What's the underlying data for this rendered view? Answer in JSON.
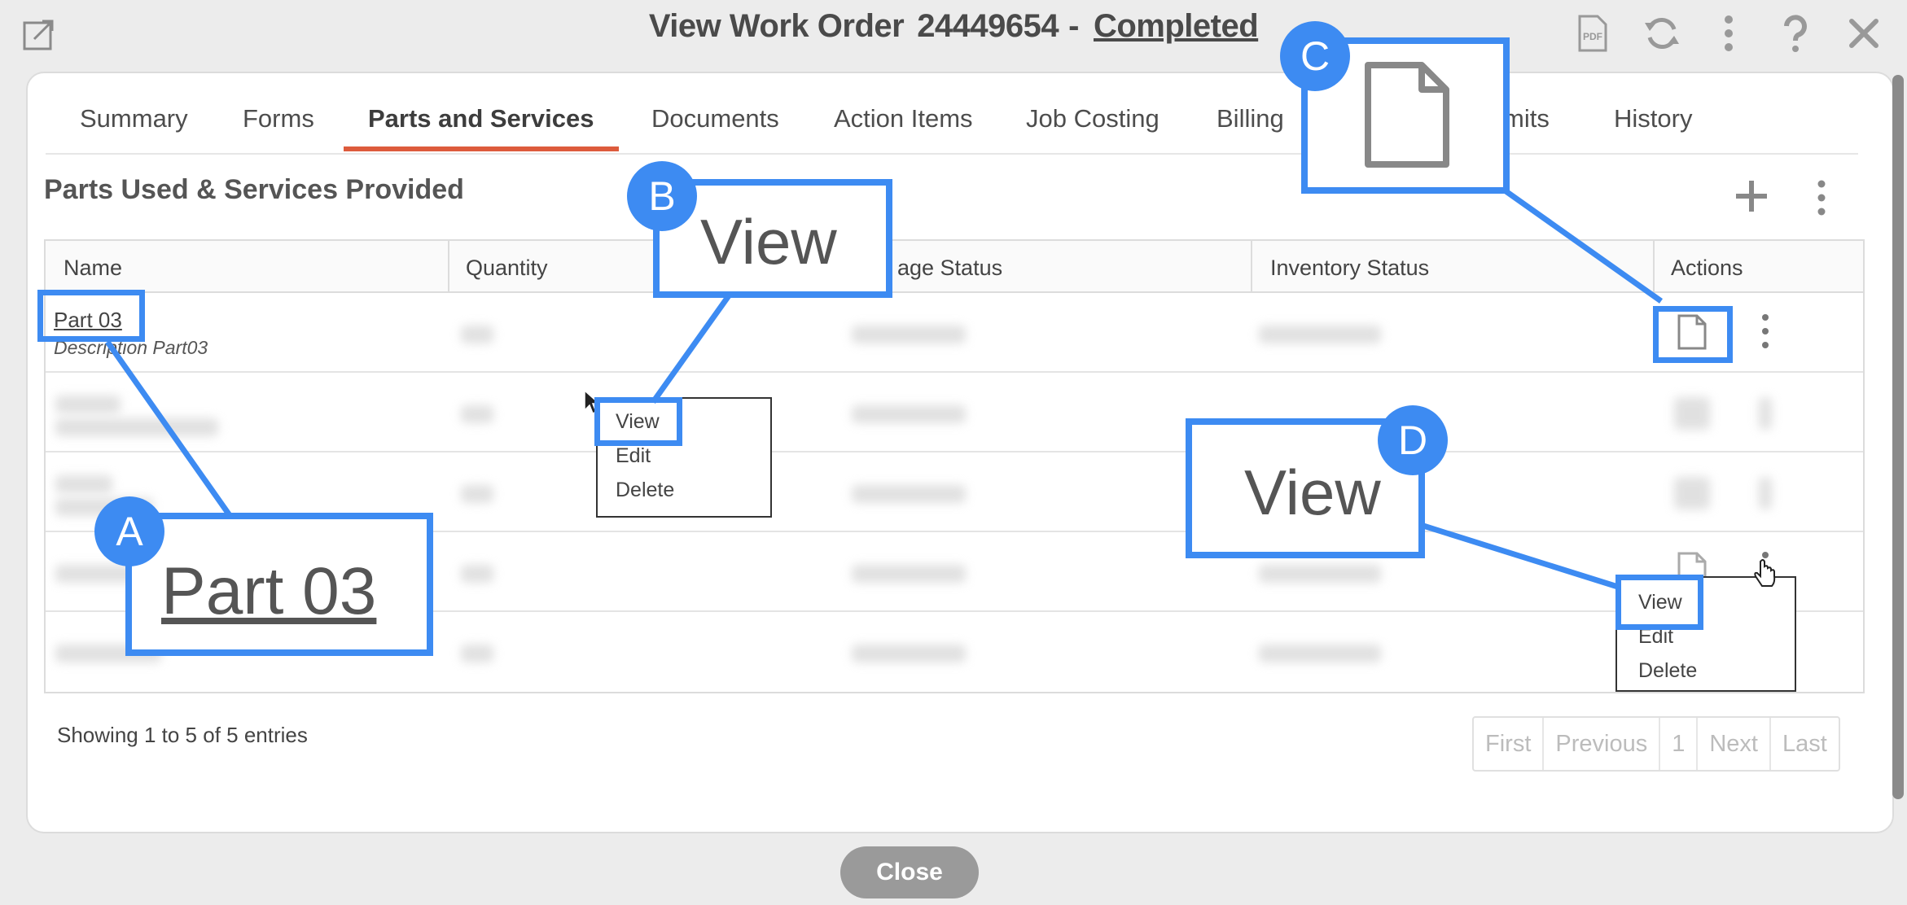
{
  "header": {
    "title_prefix": "View Work Order",
    "order_number": "24449654",
    "separator": "-",
    "status": "Completed"
  },
  "header_icons": [
    "pdf-icon",
    "refresh-icon",
    "more-vertical-icon",
    "help-icon",
    "close-icon"
  ],
  "pdf_label": "PDF",
  "tabs": [
    {
      "label": "Summary"
    },
    {
      "label": "Forms"
    },
    {
      "label": "Parts and Services",
      "active": true
    },
    {
      "label": "Documents"
    },
    {
      "label": "Action Items"
    },
    {
      "label": "Job Costing"
    },
    {
      "label": "Billing"
    },
    {
      "label": "mits"
    },
    {
      "label": "History"
    }
  ],
  "section": {
    "title": "Parts Used & Services Provided"
  },
  "table": {
    "columns": [
      "Name",
      "Quantity",
      "age Status",
      "Inventory Status",
      "Actions"
    ],
    "first_row": {
      "name": "Part 03",
      "description": "Description Part03"
    }
  },
  "footer": {
    "showing": "Showing 1 to 5 of 5 entries",
    "pager": [
      "First",
      "Previous",
      "1",
      "Next",
      "Last"
    ],
    "close_label": "Close"
  },
  "menus": {
    "menu1": [
      "View",
      "Edit",
      "Delete"
    ],
    "menu2": [
      "View",
      "Edit",
      "Delete"
    ]
  },
  "callouts": {
    "a": {
      "badge": "A",
      "text": "Part 03"
    },
    "b": {
      "badge": "B",
      "text": "View"
    },
    "c": {
      "badge": "C"
    },
    "d": {
      "badge": "D",
      "text": "View"
    }
  },
  "colors": {
    "accent": "#3d8bf2",
    "tab_underline": "#dd5b3c"
  }
}
